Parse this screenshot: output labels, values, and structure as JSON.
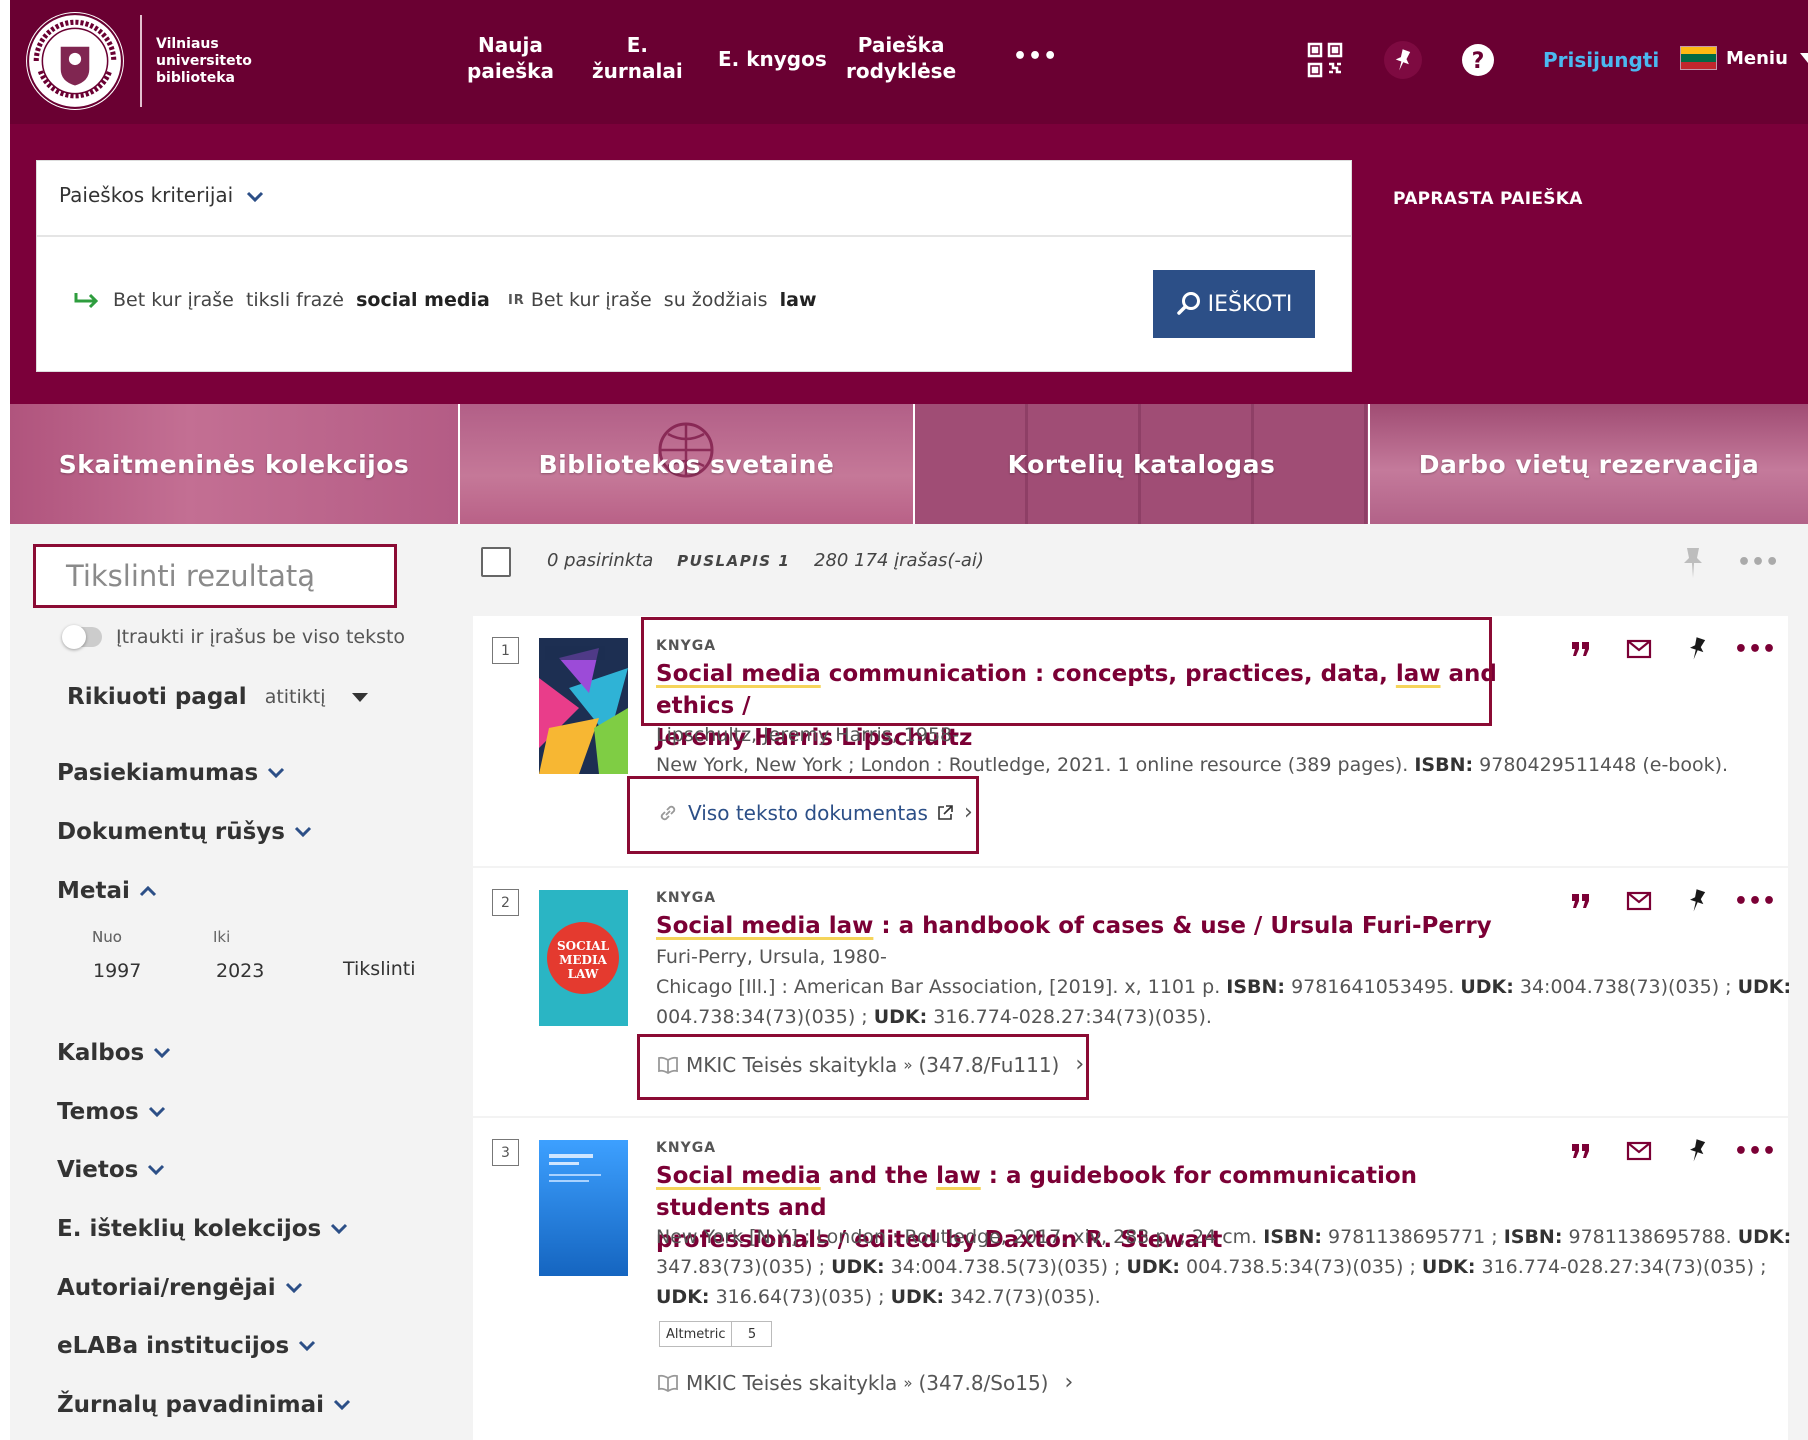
{
  "header": {
    "logo_lines": [
      "Vilniaus",
      "universiteto",
      "biblioteka"
    ],
    "nav": [
      {
        "line1": "Nauja",
        "line2": "paieška"
      },
      {
        "line1": "E.",
        "line2": "žurnalai"
      },
      {
        "line1": "E. knygos",
        "line2": ""
      },
      {
        "line1": "Paieška",
        "line2": "rodyklėse"
      }
    ],
    "more": "•••",
    "login": "Prisijungti",
    "menu": "Meniu"
  },
  "search": {
    "criteria_label": "Paieškos kriterijai",
    "query": {
      "scope1": "Bet kur įraše",
      "mode1": "tiksli frazė",
      "term1": "social media",
      "operator": "IR",
      "scope2": "Bet kur įraše",
      "mode2": "su žodžiais",
      "term2": "law"
    },
    "button_label": "IEŠKOTI",
    "simple_search": "PAPRASTA PAIEŠKA"
  },
  "tiles": [
    "Skaitmeninės kolekcijos",
    "Bibliotekos svetainė",
    "Kortelių katalogas",
    "Darbo vietų rezervacija"
  ],
  "sidebar": {
    "refine_placeholder": "Tikslinti rezultatą",
    "toggle_label": "Įtraukti ir įrašus be viso teksto",
    "sort_label": "Rikiuoti pagal",
    "sort_value": "atitiktį",
    "facets": [
      "Pasiekiamumas",
      "Dokumentų rūšys",
      "Metai",
      "Kalbos",
      "Temos",
      "Vietos",
      "E. išteklių kolekcijos",
      "Autoriai/rengėjai",
      "eLABa institucijos",
      "Žurnalų pavadinimai"
    ],
    "years": {
      "from_label": "Nuo",
      "to_label": "Iki",
      "from": "1997",
      "to": "2023",
      "apply": "Tikslinti"
    }
  },
  "results_bar": {
    "selected": "0 pasirinkta",
    "page": "PUSLAPIS 1",
    "count": "280 174 įrašas(-ai)",
    "more": "•••"
  },
  "results": [
    {
      "num": "1",
      "type": "KNYGA",
      "title_parts": [
        "Social media",
        " communication : concepts, practices, data, ",
        "law",
        " and ethics /"
      ],
      "title_line2": "Jeremy Harris Lipschultz",
      "author": "Lipschultz, Jeremy Harris, 1958-",
      "meta_plain": "New York, New York ; London : Routledge, 2021. 1 online resource (389 pages). ",
      "meta_isbn_label": "ISBN:",
      "meta_isbn": " 9780429511448 (e-book).",
      "link": "Viso teksto dokumentas"
    },
    {
      "num": "2",
      "type": "KNYGA",
      "title_hl": "Social media law",
      "title_rest": " : a handbook of cases & use / Ursula Furi-Perry",
      "author": "Furi-Perry, Ursula, 1980-",
      "meta_line1_pre": "Chicago [Ill.] : American Bar Association, [2019]. x, 1101 p. ",
      "meta_line1_isbn": "ISBN:",
      "meta_line1_isbnval": " 9781641053495. ",
      "meta_line1_udk": "UDK:",
      "meta_line1_udkval": " 34:004.738(73)(035) ; ",
      "meta_line1_udk2": "UDK:",
      "meta_line2_a": "004.738:34(73)(035) ; ",
      "meta_line2_udk": "UDK:",
      "meta_line2_b": " 316.774-028.27:34(73)(035).",
      "location": "MKIC Teisės skaitykla",
      "callno": "(347.8/Fu111)"
    },
    {
      "num": "3",
      "type": "KNYGA",
      "title_hl1": "Social media",
      "title_mid": " and the ",
      "title_hl2": "law",
      "title_rest": " : a guidebook for communication students and",
      "title_line2": "professionals / edited by Daxton R. Stewart",
      "meta_l1": "New York [N.Y.] ; London : Routledge, 2017. xiv, 283 p. ; 24 cm. ",
      "meta_l1_isbn": "ISBN:",
      "meta_l1_v1": " 9781138695771 ; ",
      "meta_l1_isbn2": "ISBN:",
      "meta_l1_v2": " 9781138695788. ",
      "meta_l1_udk": "UDK:",
      "meta_l2_a": "347.83(73)(035) ; ",
      "meta_l2_udk1": "UDK:",
      "meta_l2_b": " 34:004.738.5(73)(035) ; ",
      "meta_l2_udk2": "UDK:",
      "meta_l2_c": " 004.738.5:34(73)(035) ; ",
      "meta_l2_udk3": "UDK:",
      "meta_l2_d": " 316.774-028.27:34(73)(035) ;",
      "meta_l3_udk1": "UDK:",
      "meta_l3_a": " 316.64(73)(035) ; ",
      "meta_l3_udk2": "UDK:",
      "meta_l3_b": " 342.7(73)(035).",
      "altmetric_label": "Altmetric",
      "altmetric_score": "5",
      "location": "MKIC Teisės skaitykla",
      "callno": "(347.8/So15)"
    }
  ],
  "colors": {
    "header": "#6a0032",
    "search_band": "#7b003a",
    "accent": "#7b0035",
    "button": "#2c4f87",
    "highlight_box": "#8b0b34"
  },
  "icons": [
    "seal-logo",
    "qr-code-icon",
    "pin-icon",
    "help-icon",
    "flag-lt-icon",
    "search-icon",
    "chevron-down-icon",
    "quote-icon",
    "mail-icon",
    "link-icon",
    "external-link-icon",
    "book-icon"
  ]
}
